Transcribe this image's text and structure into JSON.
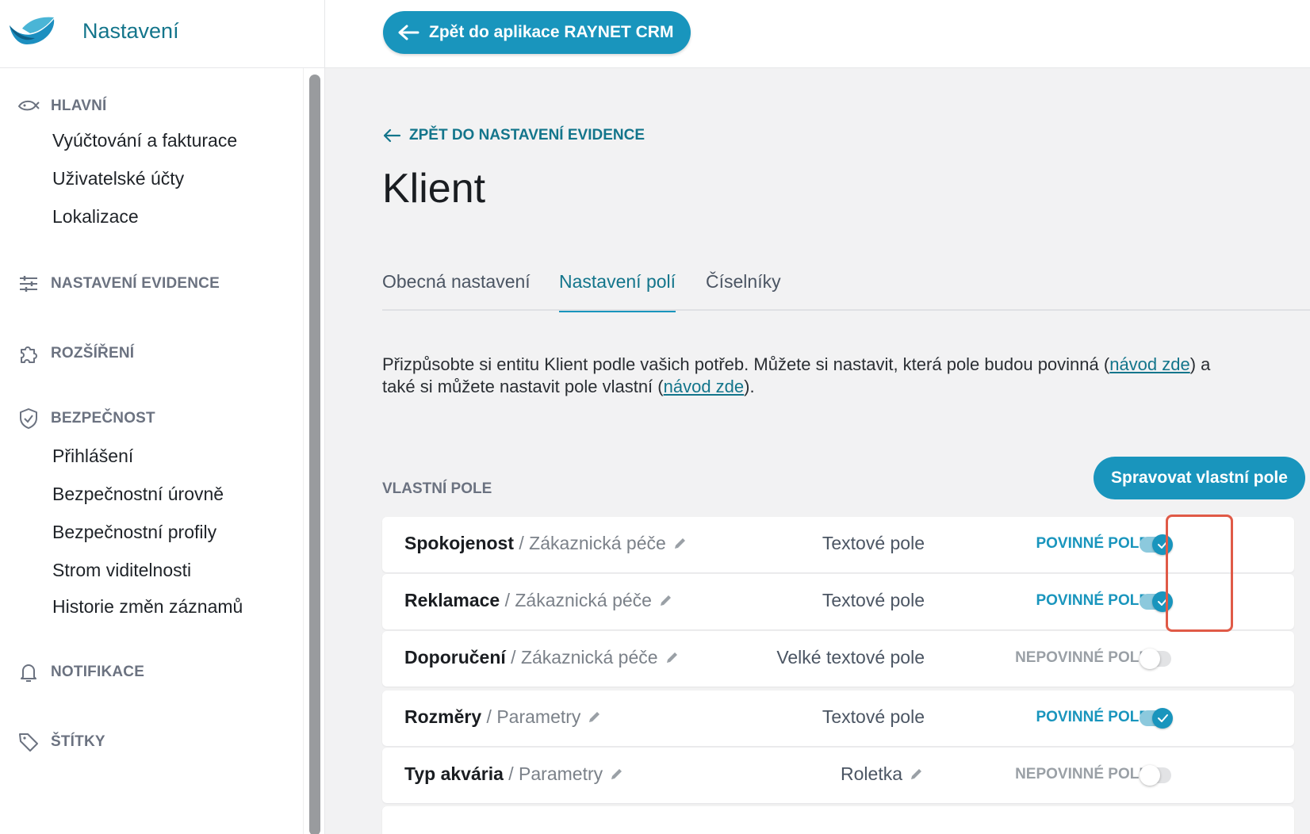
{
  "brand": {
    "title": "Nastavení"
  },
  "top_bar": {
    "back_app_label": "Zpět do aplikace RAYNET CRM"
  },
  "sidebar": {
    "sections": [
      {
        "label": "HLAVNÍ",
        "icon": "fish-icon",
        "items": [
          "Vyúčtování a fakturace",
          "Uživatelské účty",
          "Lokalizace"
        ]
      },
      {
        "label": "NASTAVENÍ EVIDENCE",
        "icon": "sliders-icon",
        "items": []
      },
      {
        "label": "ROZŠÍŘENÍ",
        "icon": "puzzle-icon",
        "items": []
      },
      {
        "label": "BEZPEČNOST",
        "icon": "shield-icon",
        "items": [
          "Přihlášení",
          "Bezpečnostní úrovně",
          "Bezpečnostní profily",
          "Strom viditelnosti",
          "Historie změn záznamů"
        ]
      },
      {
        "label": "NOTIFIKACE",
        "icon": "bell-icon",
        "items": []
      },
      {
        "label": "ŠTÍTKY",
        "icon": "tag-icon",
        "items": []
      }
    ]
  },
  "main": {
    "back_link": "ZPĚT DO NASTAVENÍ EVIDENCE",
    "title": "Klient",
    "tabs": [
      {
        "label": "Obecná nastavení",
        "active": false
      },
      {
        "label": "Nastavení polí",
        "active": true
      },
      {
        "label": "Číselníky",
        "active": false
      }
    ],
    "description": {
      "part1": "Přizpůsobte si entitu Klient podle vašich potřeb. Můžete si nastavit, která pole budou povinná (",
      "link1": "návod zde",
      "part2": ") a také si můžete nastavit pole vlastní (",
      "link2": "návod zde",
      "part3": ")."
    },
    "custom_fields_label": "VLASTNÍ POLE",
    "manage_button": "Spravovat vlastní pole",
    "fields": [
      {
        "name": "Spokojenost",
        "group": "/ Zákaznická péče",
        "type": "Textové pole",
        "required_label": "POVINNÉ POLE",
        "required": true,
        "type_editable": false
      },
      {
        "name": "Reklamace",
        "group": "/ Zákaznická péče",
        "type": "Textové pole",
        "required_label": "POVINNÉ POLE",
        "required": true,
        "type_editable": false
      },
      {
        "name": "Doporučení",
        "group": "/ Zákaznická péče",
        "type": "Velké textové pole",
        "required_label": "NEPOVINNÉ POLE",
        "required": false,
        "type_editable": false
      },
      {
        "name": "Rozměry",
        "group": "/ Parametry",
        "type": "Textové pole",
        "required_label": "POVINNÉ POLE",
        "required": true,
        "type_editable": false
      },
      {
        "name": "Typ akvária",
        "group": "/ Parametry",
        "type": "Roletka",
        "required_label": "NEPOVINNÉ POLE",
        "required": false,
        "type_editable": true
      }
    ]
  },
  "colors": {
    "accent": "#1995bd",
    "accent_dark": "#13758b",
    "highlight": "#e05a47",
    "background": "#f2f2f3"
  }
}
